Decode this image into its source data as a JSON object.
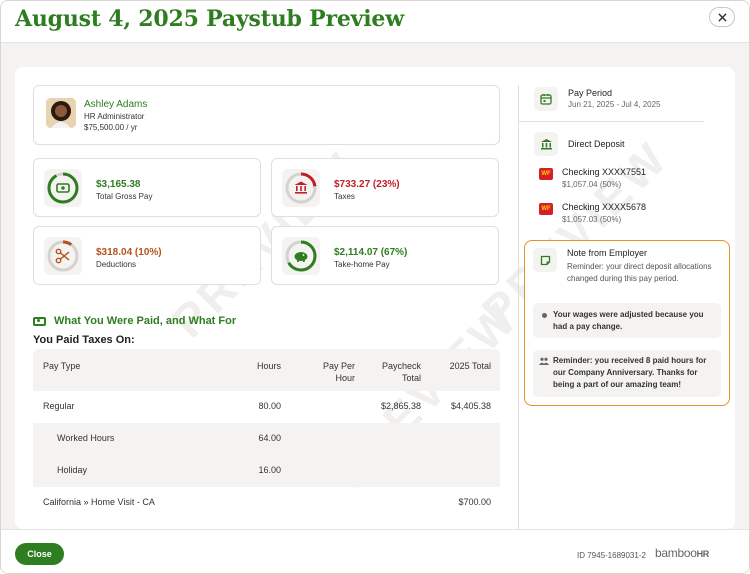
{
  "header": {
    "title": "August 4, 2025 Paystub Preview",
    "close_icon": "close-icon"
  },
  "watermark": "PREVIEW",
  "employee": {
    "name": "Ashley Adams",
    "role": "HR Administrator",
    "salary": "$75,500.00 / yr"
  },
  "stats": [
    {
      "value": "$3,165.38",
      "label": "Total Gross Pay",
      "color": "#2e7d20",
      "icon": "money-icon",
      "fraction": 0.92
    },
    {
      "value": "$733.27 (23%)",
      "label": "Taxes",
      "color": "#c0202a",
      "icon": "bank-icon",
      "fraction": 0.23
    },
    {
      "value": "$318.04 (10%)",
      "label": "Deductions",
      "color": "#b5521c",
      "icon": "scissors-icon",
      "fraction": 0.1
    },
    {
      "value": "$2,114.07 (67%)",
      "label": "Take-home Pay",
      "color": "#2e7d20",
      "icon": "piggy-bank-icon",
      "fraction": 0.67
    }
  ],
  "section": {
    "title": "What You Were Paid, and What For",
    "subtitle": "You Paid Taxes On:"
  },
  "table": {
    "headers": {
      "pay_type": "Pay Type",
      "hours": "Hours",
      "pay_per_hour": "Pay Per Hour",
      "paycheck_total": "Paycheck Total",
      "ytd_total": "2025 Total"
    },
    "rows": [
      {
        "pay_type": "Regular",
        "hours": "80.00",
        "pay_per_hour": "",
        "paycheck_total": "$2,865.38",
        "ytd_total": "$4,405.38"
      },
      {
        "pay_type": "Worked Hours",
        "hours": "64.00",
        "pay_per_hour": "",
        "paycheck_total": "",
        "ytd_total": ""
      },
      {
        "pay_type": "Holiday",
        "hours": "16.00",
        "pay_per_hour": "",
        "paycheck_total": "",
        "ytd_total": ""
      },
      {
        "pay_type": "California » Home Visit - CA",
        "hours": "",
        "pay_per_hour": "",
        "paycheck_total": "",
        "ytd_total": "$700.00"
      }
    ]
  },
  "sidebar": {
    "pay_period": {
      "title": "Pay Period",
      "value": "Jun 21, 2025 - Jul 4, 2025"
    },
    "direct_deposit": {
      "title": "Direct Deposit",
      "accounts": [
        {
          "name": "Checking XXXX7551",
          "amount": "$1,057.04 (50%)",
          "bank_badge": "WF"
        },
        {
          "name": "Checking XXXX5678",
          "amount": "$1,057.03 (50%)",
          "bank_badge": "WF"
        }
      ]
    },
    "note": {
      "title": "Note from Employer",
      "text": "Reminder: your direct deposit allocations changed during this pay period.",
      "messages": [
        "Your wages were adjusted because you had a pay change.",
        "Reminder: you received 8 paid hours for our Company Anniversary. Thanks for being a part of our amazing team!"
      ],
      "highlight_color": "#e5922a"
    }
  },
  "footer": {
    "close_label": "Close",
    "doc_id": "ID 7945-1689031-2",
    "brand": "bamboo",
    "brand_suffix": "HR"
  }
}
